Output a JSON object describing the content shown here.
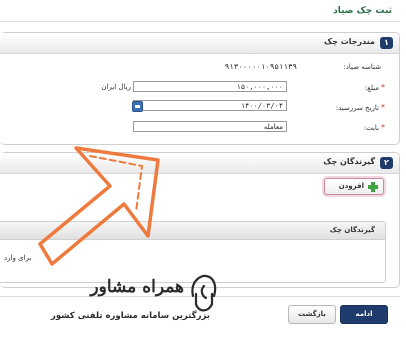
{
  "page": {
    "title": "ثبت چک صیاد"
  },
  "section1": {
    "number": "۱",
    "title": "مندرجات چک",
    "fields": {
      "sayad_label": "شناسه صیاد:",
      "sayad_value": "۹۱۳۰۰۰۰۰۱۰۹۵۱۱۳۹",
      "amount_label": "مبلغ:",
      "amount_value": "۱۵۰,۰۰۰,۰۰۰",
      "currency": "ریال ایران",
      "due_label": "تاریخ سررسید:",
      "due_value": "۱۴۰۰/۰۳/۰۴",
      "reason_label": "بابت:",
      "reason_value": "معامله"
    }
  },
  "section2": {
    "number": "۲",
    "title": "گیرندگان چک",
    "add_button": "افزودن",
    "receivers_table_title": "گیرندگان چک",
    "empty_text": "برای وارد"
  },
  "watermark": {
    "brand": "همراه مشاور",
    "tagline": "بزرگترین سامانه مشاوره تلفنی کشور"
  },
  "buttons": {
    "continue": "ادامه",
    "back": "بازگشت"
  },
  "colors": {
    "accent": "#1f3b6b",
    "title_green": "#2c6e49",
    "arrow": "#ef7a3d",
    "add_icon": "#3fa33f"
  },
  "icons": {
    "calendar": "calendar-icon",
    "add": "plus-icon",
    "pointer": "arrow-pointer-icon"
  }
}
